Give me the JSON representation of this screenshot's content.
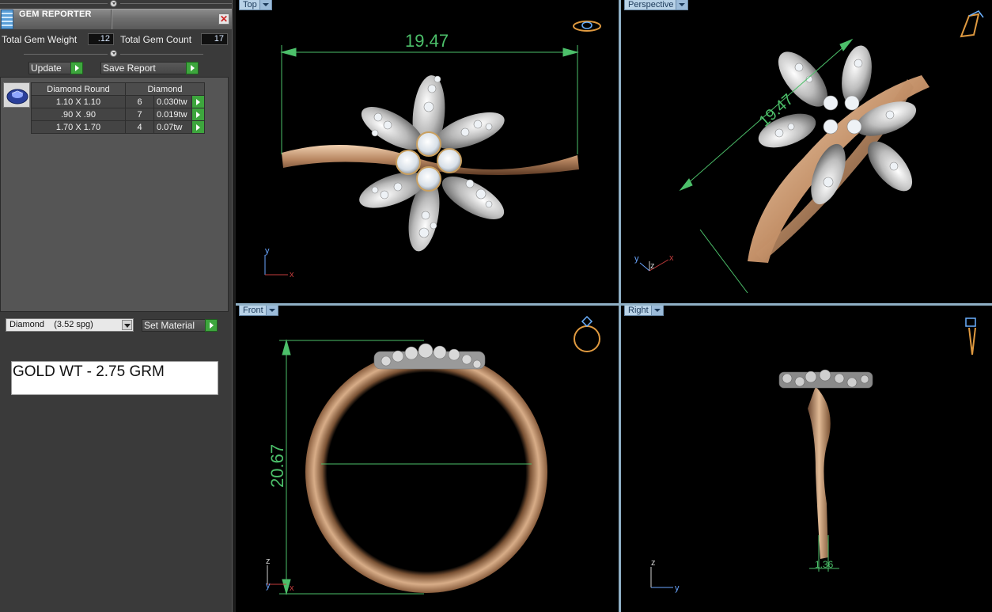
{
  "panel": {
    "title": "GEM REPORTER",
    "close_glyph": "✕",
    "total_gem_weight_label": "Total Gem Weight",
    "total_gem_weight_value": ".12",
    "total_gem_count_label": "Total Gem Count",
    "total_gem_count_value": "17",
    "update_label": "Update",
    "save_report_label": "Save Report",
    "table": {
      "headers": [
        "Diamond Round",
        "Diamond"
      ],
      "rows": [
        {
          "size": "1.10 X 1.10",
          "count": "6",
          "weight": "0.030tw"
        },
        {
          "size": ".90 X .90",
          "count": "7",
          "weight": "0.019tw"
        },
        {
          "size": "1.70 X 1.70",
          "count": "4",
          "weight": "0.07tw"
        }
      ]
    },
    "material_value": "Diamond    (3.52 spg)",
    "set_material_label": "Set Material",
    "note": "GOLD WT - 2.75 GRM"
  },
  "viewports": {
    "top": {
      "label": "Top",
      "dimension": "19.47",
      "axis_y": "y",
      "axis_x": "x"
    },
    "perspective": {
      "label": "Perspective",
      "dimension": "19.47",
      "axis_y": "y",
      "axis_z": "z",
      "axis_x": "x"
    },
    "front": {
      "label": "Front",
      "dimension": "20.67",
      "axis_z": "z",
      "axis_y": "y",
      "axis_x": "x"
    },
    "right": {
      "label": "Right",
      "dimension": "1.36",
      "axis_z": "z",
      "axis_y": "y"
    }
  },
  "icons": [
    "gem-reporter-icon",
    "close-icon",
    "gem-thumbnail-icon",
    "view-ring-icon"
  ],
  "colors": {
    "dimension": "#4cc06a",
    "gold": "#c99a72",
    "silver": "#c9c9c9",
    "tab": "#b9d3e8",
    "go": "#3da63d"
  }
}
